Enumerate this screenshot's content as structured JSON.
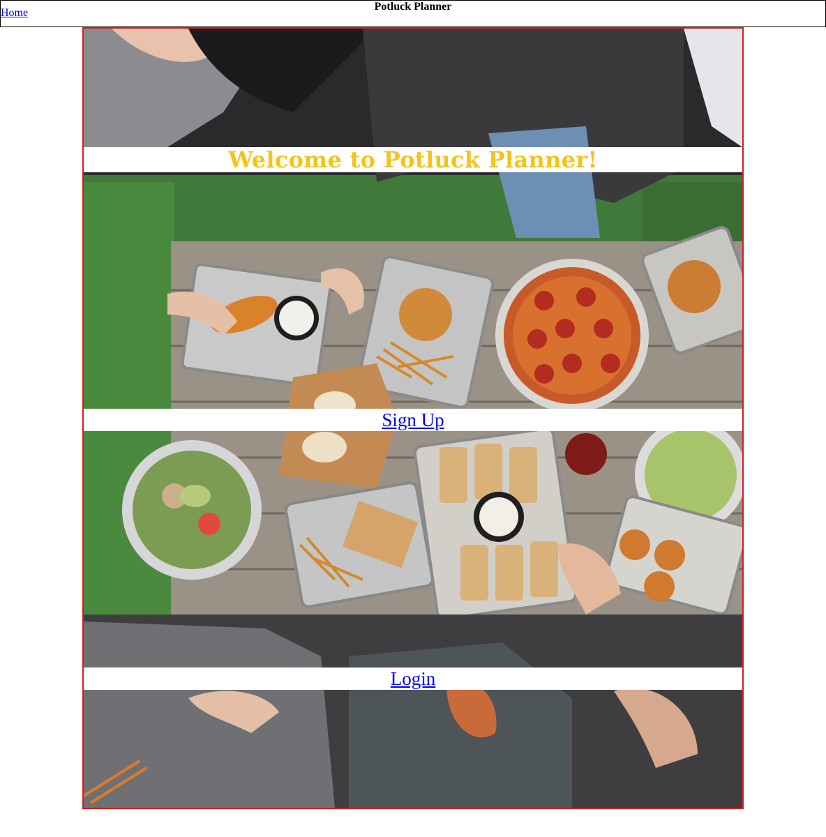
{
  "header": {
    "title": "Potluck Planner",
    "home_link": "Home"
  },
  "hero": {
    "image_icon": "food-table-photo",
    "welcome": "Welcome to Potluck Planner!",
    "signup_link": "Sign Up",
    "login_link": "Login"
  },
  "colors": {
    "frame_border": "#d21f1f",
    "welcome_text": "#f2c51a",
    "link": "#0000ee"
  }
}
